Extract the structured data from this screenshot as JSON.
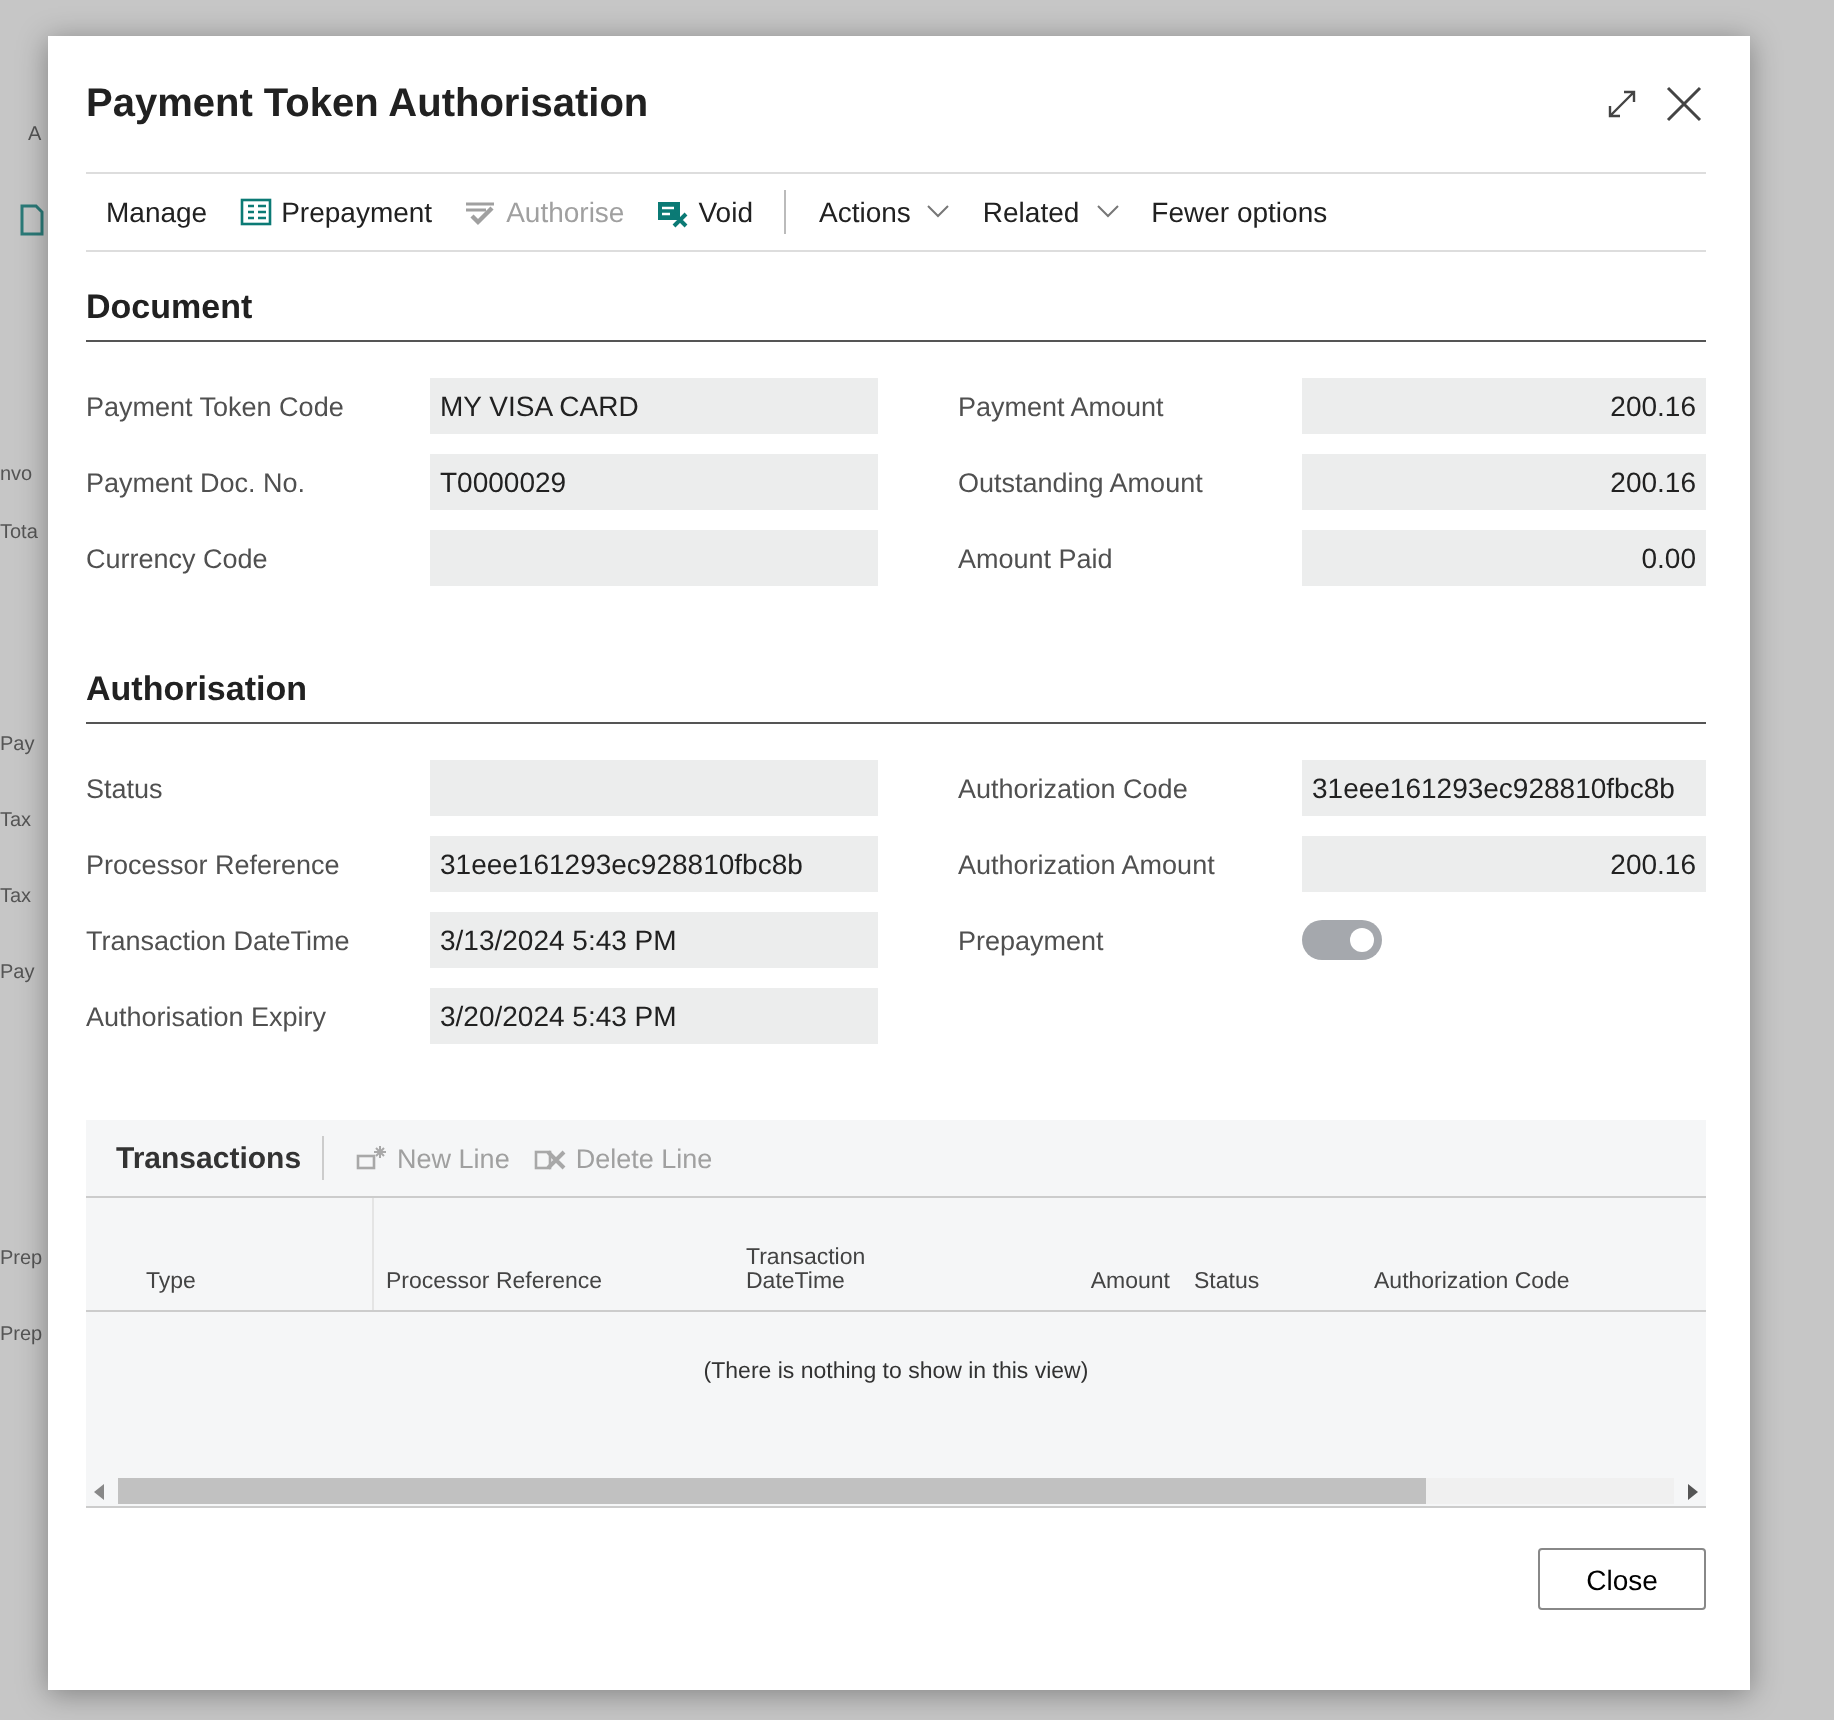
{
  "background_page": {
    "header_label": "A",
    "sections": [
      [
        "nvo",
        "Tota"
      ],
      [
        "Pay",
        "Tax",
        "Tax",
        "Pay"
      ],
      [
        "Prep",
        "Prep"
      ]
    ]
  },
  "dialog": {
    "title": "Payment Token Authorisation",
    "toolbar": [
      {
        "kind": "text",
        "label": "Manage",
        "disabled": false
      },
      {
        "kind": "action",
        "label": "Prepayment",
        "disabled": false
      },
      {
        "kind": "action",
        "label": "Authorise",
        "disabled": true
      },
      {
        "kind": "action",
        "label": "Void",
        "disabled": false
      },
      {
        "kind": "separator"
      },
      {
        "kind": "menu",
        "label": "Actions",
        "disabled": false
      },
      {
        "kind": "menu",
        "label": "Related",
        "disabled": false
      },
      {
        "kind": "text",
        "label": "Fewer options",
        "disabled": false
      }
    ],
    "sections": [
      {
        "title": "Document",
        "left": [
          {
            "kind": "text",
            "label": "Payment Token Code",
            "value": "MY VISA CARD"
          },
          {
            "kind": "text",
            "label": "Payment Doc. No.",
            "value": "T0000029"
          },
          {
            "kind": "text",
            "label": "Currency Code"
          }
        ],
        "right": [
          {
            "kind": "number",
            "label": "Payment Amount",
            "value": "200.16"
          },
          {
            "kind": "number",
            "label": "Outstanding Amount",
            "value": "200.16"
          },
          {
            "kind": "number",
            "label": "Amount Paid",
            "value": "0.00"
          }
        ]
      },
      {
        "title": "Authorisation",
        "left": [
          {
            "kind": "text",
            "label": "Status"
          },
          {
            "kind": "text",
            "label": "Processor Reference",
            "value": "31eee161293ec928810fbc8b"
          },
          {
            "kind": "text",
            "label": "Transaction DateTime",
            "value": "3/13/2024 5:43 PM"
          },
          {
            "kind": "text",
            "label": "Authorisation Expiry",
            "value": "3/20/2024 5:43 PM"
          }
        ],
        "right": [
          {
            "kind": "text",
            "label": "Authorization Code",
            "value": "31eee161293ec928810fbc8b"
          },
          {
            "kind": "number",
            "label": "Authorization Amount",
            "value": "200.16"
          },
          {
            "kind": "toggle",
            "label": "Prepayment",
            "on": true
          }
        ]
      }
    ],
    "transactions": {
      "title": "Transactions",
      "actions": [
        {
          "label": "New Line",
          "disabled": true
        },
        {
          "label": "Delete Line",
          "disabled": true
        }
      ],
      "columns": [
        {
          "label": "Type",
          "kind": "text"
        },
        {
          "label": "Processor Reference",
          "kind": "text"
        },
        {
          "label": "Transaction DateTime",
          "kind": "text"
        },
        {
          "label": "Amount",
          "kind": "number"
        },
        {
          "label": "Status",
          "kind": "text"
        },
        {
          "label": "Authorization Code",
          "kind": "text"
        }
      ],
      "empty_text": "(There is nothing to show in this view)"
    },
    "buttons": [
      "Close"
    ]
  }
}
